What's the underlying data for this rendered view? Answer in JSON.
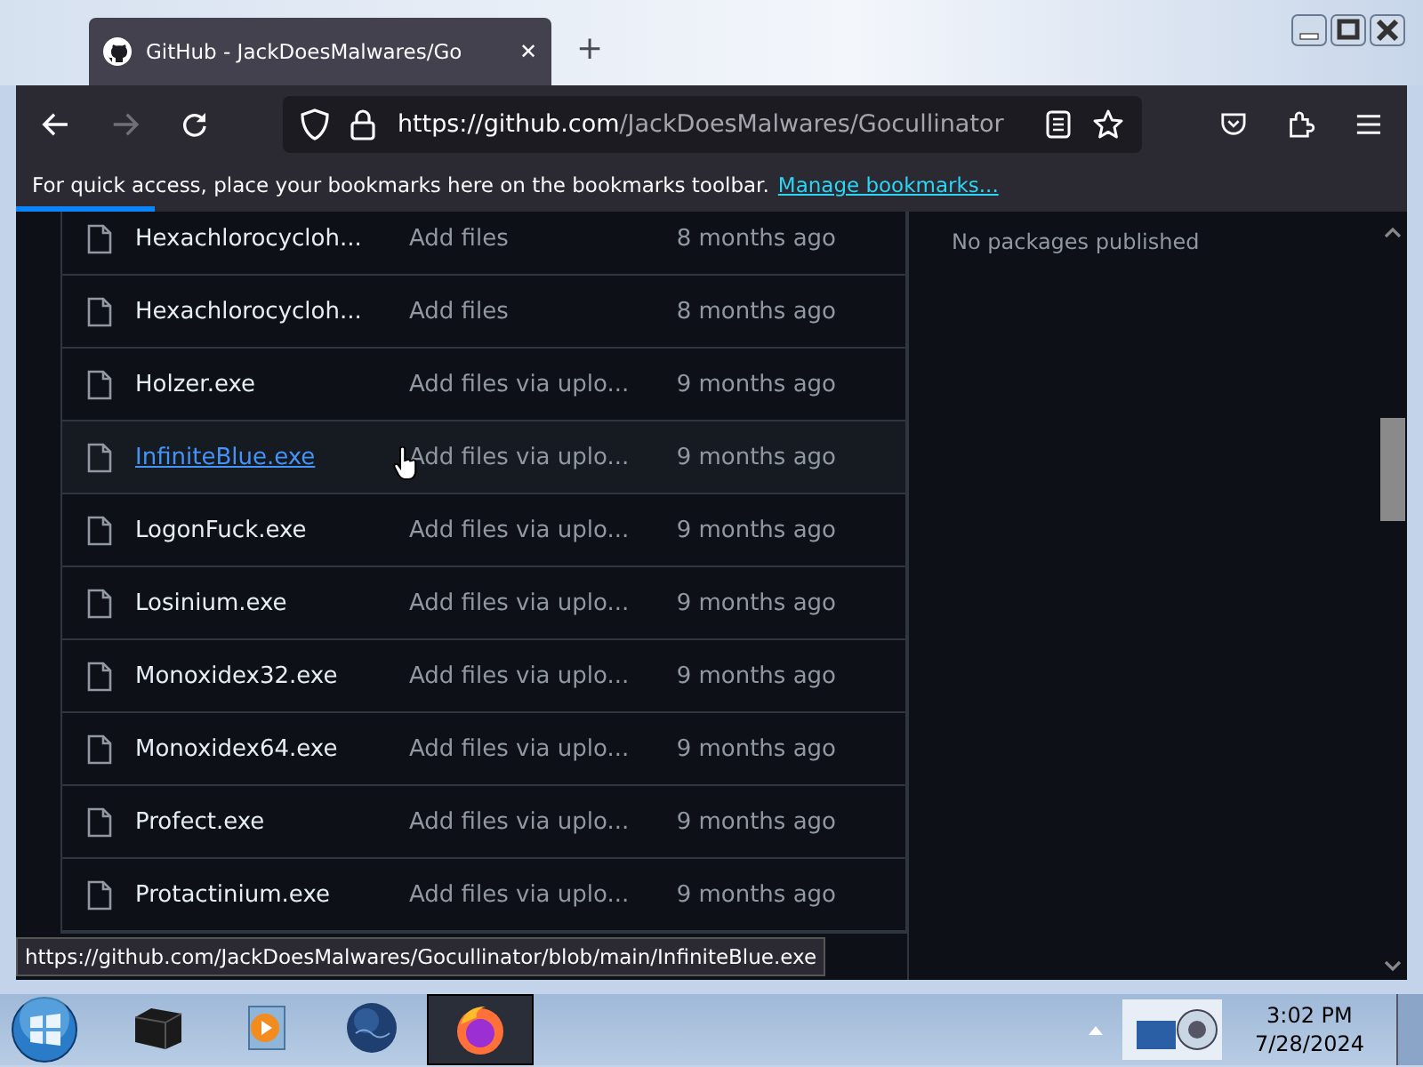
{
  "browser": {
    "tab_title": "GitHub - JackDoesMalwares/Go",
    "tab_close": "✕",
    "new_tab": "+",
    "url_host": "https://github.com",
    "url_path": "/JackDoesMalwares/Gocullinator",
    "bookmarks_text": "For quick access, place your bookmarks here on the bookmarks toolbar.",
    "bookmarks_link": "Manage bookmarks...",
    "loading_bar": {
      "level": 0.1
    }
  },
  "files": [
    {
      "name": "Hexachlorocycloh...",
      "message": "Add files",
      "time": "8 months ago",
      "hovered": false
    },
    {
      "name": "Hexachlorocycloh...",
      "message": "Add files",
      "time": "8 months ago",
      "hovered": false
    },
    {
      "name": "Holzer.exe",
      "message": "Add files via uplo...",
      "time": "9 months ago",
      "hovered": false
    },
    {
      "name": "InfiniteBlue.exe",
      "message": "Add files via uplo...",
      "time": "9 months ago",
      "hovered": true
    },
    {
      "name": "LogonFuck.exe",
      "message": "Add files via uplo...",
      "time": "9 months ago",
      "hovered": false
    },
    {
      "name": "Losinium.exe",
      "message": "Add files via uplo...",
      "time": "9 months ago",
      "hovered": false
    },
    {
      "name": "Monoxidex32.exe",
      "message": "Add files via uplo...",
      "time": "9 months ago",
      "hovered": false
    },
    {
      "name": "Monoxidex64.exe",
      "message": "Add files via uplo...",
      "time": "9 months ago",
      "hovered": false
    },
    {
      "name": "Profect.exe",
      "message": "Add files via uplo...",
      "time": "9 months ago",
      "hovered": false
    },
    {
      "name": "Protactinium.exe",
      "message": "Add files via uplo...",
      "time": "9 months ago",
      "hovered": false
    }
  ],
  "sidebar": {
    "packages": "No packages published"
  },
  "status_url": "https://github.com/JackDoesMalwares/Gocullinator/blob/main/InfiniteBlue.exe",
  "taskbar": {
    "apps": [
      {
        "kind": "printer",
        "selected": false
      },
      {
        "kind": "media",
        "selected": false
      },
      {
        "kind": "globe",
        "selected": false
      },
      {
        "kind": "firefox",
        "selected": true
      }
    ],
    "time": "3:02 PM",
    "date": "7/28/2024"
  }
}
